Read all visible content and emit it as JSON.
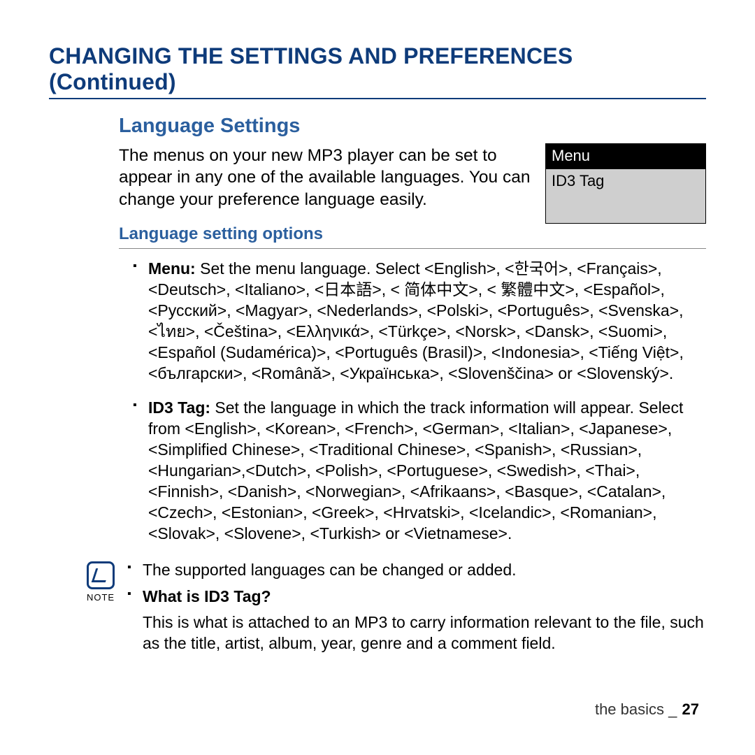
{
  "title": "CHANGING THE SETTINGS AND PREFERENCES (Continued)",
  "section": {
    "heading": "Language Settings",
    "intro": "The menus on your new MP3 player can be set to appear in any one of the available languages. You can change your preference language easily.",
    "menu_box": {
      "header": "Menu",
      "item": "ID3 Tag"
    },
    "sub_heading": "Language setting options",
    "options": {
      "menu": {
        "label": "Menu:",
        "text": " Set the menu language. Select <English>, <한국어>, <Français>, <Deutsch>, <Italiano>, <日本語>, < 简体中文>, < 繁體中文>, <Español>, <Русский>, <Magyar>, <Nederlands>, <Polski>, <Português>, <Svenska>, <ไทย>, <Čeština>, <Ελληνικά>, <Türkçe>, <Norsk>, <Dansk>, <Suomi>, <Español (Sudamérica)>, <Português (Brasil)>, <Indonesia>, <Tiếng Việt>, <български>, <Română>, <Українська>, <Slovenščina> or <Slovenský>."
      },
      "id3": {
        "label": "ID3 Tag:",
        "text": " Set the language in which the track information will appear. Select from <English>, <Korean>, <French>, <German>, <Italian>, <Japanese>, <Simplified Chinese>, <Traditional Chinese>, <Spanish>, <Russian>, <Hungarian>,<Dutch>, <Polish>, <Portuguese>, <Swedish>, <Thai>, <Finnish>, <Danish>, <Norwegian>, <Afrikaans>,  <Basque>, <Catalan>, <Czech>, <Estonian>, <Greek>, <Hrvatski>, <Icelandic>, <Romanian>, <Slovak>, <Slovene>, <Turkish> or <Vietnamese>."
      }
    },
    "note": {
      "label": "NOTE",
      "line1": "The supported languages can be changed or added.",
      "question": "What is ID3 Tag?",
      "answer": "This is what is attached to an MP3 to carry information relevant to the file, such as the title, artist, album, year, genre and a comment field."
    }
  },
  "footer": {
    "section_name": "the basics",
    "separator": "_",
    "page_number": "27"
  }
}
